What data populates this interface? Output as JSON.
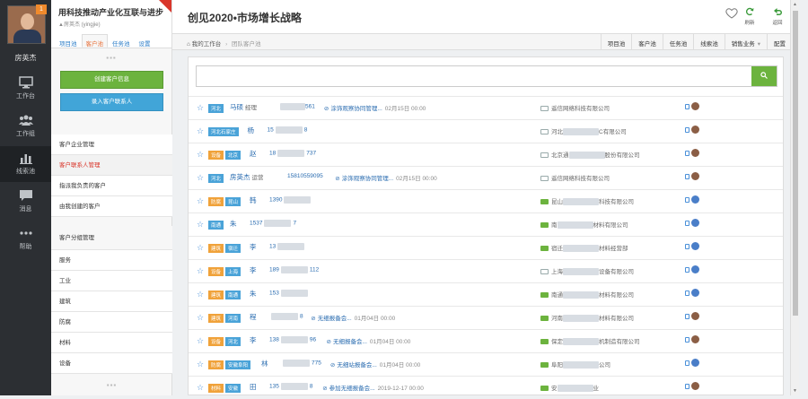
{
  "user": {
    "name": "房英杰",
    "badge": "1"
  },
  "rail": [
    {
      "label": "工作台",
      "icon": "monitor-icon"
    },
    {
      "label": "工作组",
      "icon": "team-icon"
    },
    {
      "label": "线索池",
      "icon": "chart-icon"
    },
    {
      "label": "消息",
      "icon": "message-icon"
    },
    {
      "label": "帮助",
      "icon": "more-icon"
    }
  ],
  "sidebar": {
    "title": "用科技推动产业化互联与进步",
    "subtitle": "▲房英杰 (yingjie)",
    "tabs": [
      "项目池",
      "客户池",
      "任务池",
      "设置"
    ],
    "create_customer": "创建客户信息",
    "create_contact": "录入客户联系人",
    "menu": [
      "客户企业管理",
      "客户联系人管理",
      "指派我负责的客户",
      "由我创建的客户"
    ],
    "group_title": "客户分组管理",
    "groups": [
      "服务",
      "工业",
      "建筑",
      "防腐",
      "材料",
      "设备"
    ]
  },
  "header": {
    "title": "创见2020•市场增长战略",
    "refresh": "刷新",
    "back": "返回"
  },
  "breadcrumb": {
    "home": "我的工作台",
    "current": "团队客户池"
  },
  "nav": [
    "项目池",
    "客户池",
    "任务池",
    "线索池",
    "销售业务",
    "配置"
  ],
  "rows": [
    {
      "tags": [
        "河北"
      ],
      "name": "马硕",
      "title": "经理",
      "phone": "561",
      "follow": "涂饰观察协同管理...",
      "date": "02月15日 00:00",
      "company_a": "",
      "company_b": "遥信网络科技有限公司",
      "green": false
    },
    {
      "tags": [
        "河北石家庄"
      ],
      "name": "杨",
      "title": "",
      "phone": "15",
      "phone2": "8",
      "follow": "",
      "date": "",
      "company_a": "河北",
      "company_b": "C有限公司",
      "green": false
    },
    {
      "tags": [
        "设备",
        "北京"
      ],
      "name": "赵",
      "title": "",
      "phone": "18",
      "phone2": "737",
      "follow": "",
      "date": "",
      "company_a": "北京通",
      "company_b": "股份有限公司",
      "green": false
    },
    {
      "tags": [
        "河北"
      ],
      "name": "房英杰",
      "title": "运营",
      "phone": "15810559095",
      "follow": "涂饰观察协同管理...",
      "date": "02月15日 00:00",
      "company_a": "",
      "company_b": "遥信网络科技有限公司",
      "green": false
    },
    {
      "tags": [
        "防腐",
        "昆山"
      ],
      "name": "韩",
      "title": "",
      "phone": "1390",
      "phone2": "",
      "follow": "",
      "date": "",
      "company_a": "昆山",
      "company_b": "科技有限公司",
      "green": true
    },
    {
      "tags": [
        "南通"
      ],
      "name": "朱",
      "title": "",
      "phone": "1537",
      "phone2": "7",
      "follow": "",
      "date": "",
      "company_a": "南",
      "company_b": "材料有限公司",
      "green": true
    },
    {
      "tags": [
        "建筑",
        "宿迁"
      ],
      "name": "李",
      "title": "",
      "phone": "13",
      "phone2": "",
      "follow": "",
      "date": "",
      "company_a": "宿迁",
      "company_b": "材料经营部",
      "green": true
    },
    {
      "tags": [
        "设备",
        "上海"
      ],
      "name": "李",
      "title": "",
      "phone": "189",
      "phone2": "112",
      "follow": "",
      "date": "",
      "company_a": "上海",
      "company_b": "设备有限公司",
      "green": false
    },
    {
      "tags": [
        "建筑",
        "南通"
      ],
      "name": "朱",
      "title": "",
      "phone": "153",
      "phone2": "",
      "follow": "",
      "date": "",
      "company_a": "南通",
      "company_b": "材料有限公司",
      "green": true
    },
    {
      "tags": [
        "建筑",
        "河南"
      ],
      "name": "程",
      "title": "",
      "phone": "",
      "phone2": "8",
      "follow": "无细报备会...",
      "date": "01月04日 00:00",
      "company_a": "河南",
      "company_b": "材料有限公司",
      "green": true
    },
    {
      "tags": [
        "设备",
        "河北"
      ],
      "name": "李",
      "title": "",
      "phone": "138",
      "phone2": "96",
      "follow": "无细报备会...",
      "date": "01月04日 00:00",
      "company_a": "保定",
      "company_b": "机制造有限公司",
      "green": true
    },
    {
      "tags": [
        "防腐",
        "安徽阜阳"
      ],
      "name": "林",
      "title": "",
      "phone": "",
      "phone2": "775",
      "follow": "无细站报备会...",
      "date": "01月04日 00:00",
      "company_a": "阜阳",
      "company_b": "公司",
      "green": true
    },
    {
      "tags": [
        "材料",
        "安徽"
      ],
      "name": "田",
      "title": "",
      "phone": "135",
      "phone2": "8",
      "follow": "参加无细报备会...",
      "date": "2019-12-17 00:00",
      "company_a": "安",
      "company_b": "业",
      "green": true
    }
  ],
  "colors": {
    "green": "#6cb33e",
    "blue": "#41a5d8",
    "orange": "#f0a23a",
    "red": "#d9362b"
  }
}
